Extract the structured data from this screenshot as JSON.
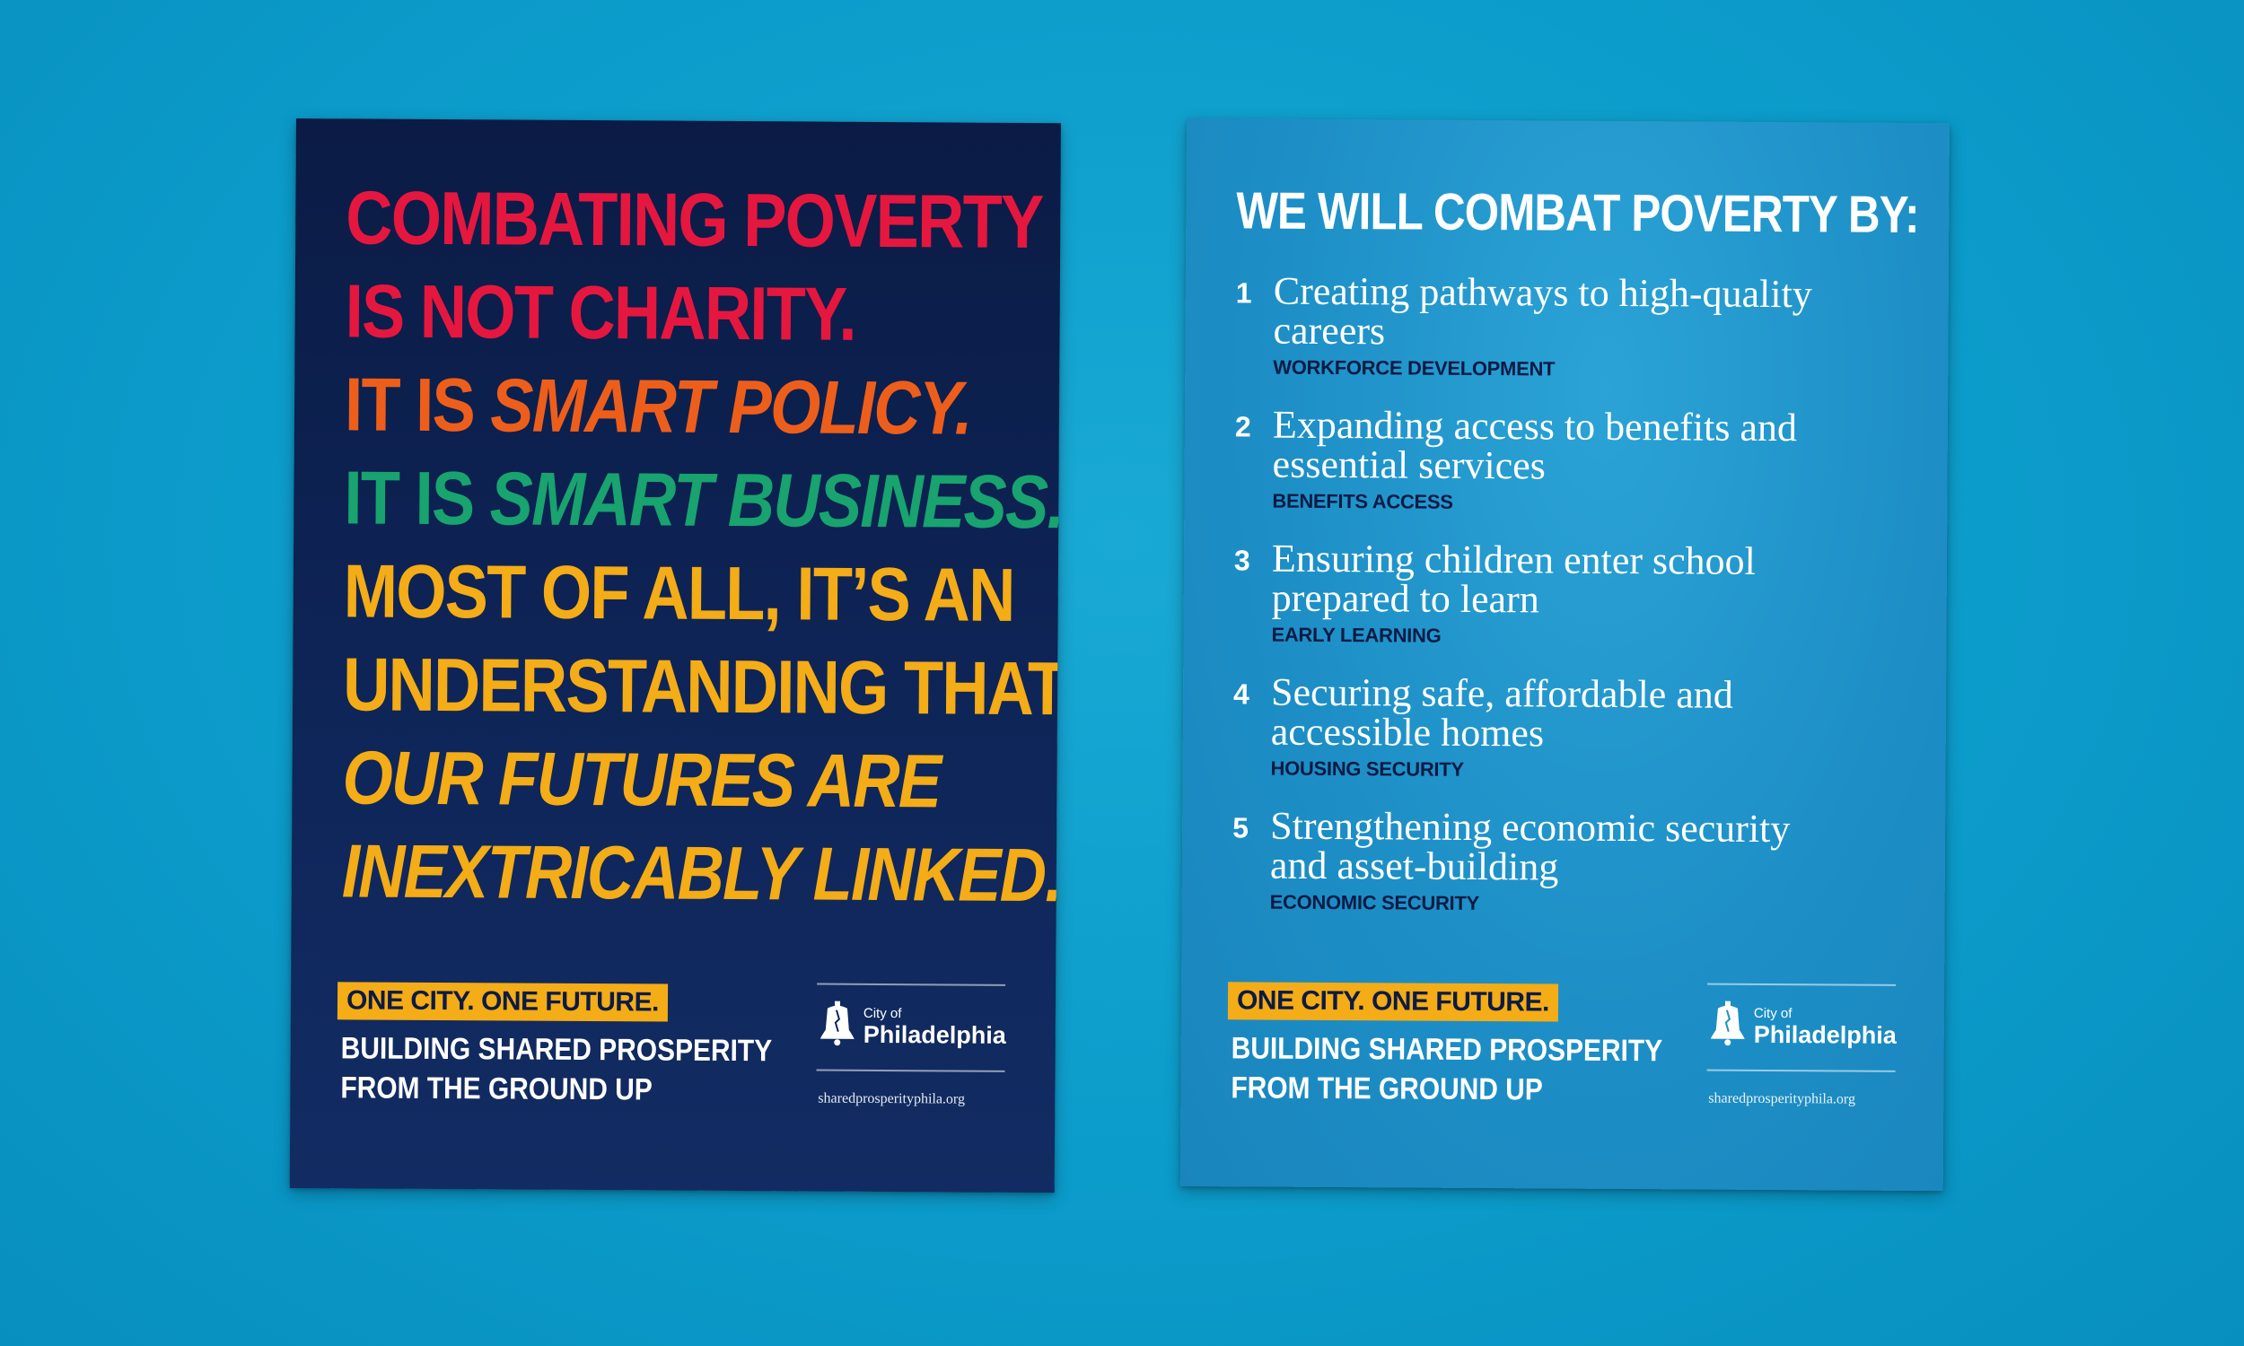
{
  "left_poster": {
    "headline": [
      {
        "text": "COMBATING POVERTY",
        "color": "#e5173f"
      },
      {
        "text": "IS NOT CHARITY.",
        "color": "#e5173f"
      },
      {
        "prefix": "IT IS ",
        "emphasis": "SMART POLICY.",
        "color": "#ee5e1b"
      },
      {
        "prefix": "IT IS ",
        "emphasis": "SMART BUSINESS.",
        "color": "#18a36f"
      },
      {
        "text": "MOST OF ALL, IT’S AN",
        "color": "#f4ac17"
      },
      {
        "text": "UNDERSTANDING THAT",
        "color": "#f4ac17"
      },
      {
        "emphasis": "OUR FUTURES ARE",
        "color": "#f4ac17"
      },
      {
        "emphasis": "INEXTRICABLY LINKED.",
        "color": "#f4ac17"
      }
    ],
    "tagline": "ONE CITY. ONE FUTURE.",
    "subtagline_1": "BUILDING SHARED PROSPERITY",
    "subtagline_2": "FROM THE GROUND UP",
    "logo": {
      "small": "City of",
      "big": "Philadelphia",
      "icon": "liberty-bell-icon"
    },
    "url": "sharedprosperityphila.org"
  },
  "right_poster": {
    "title": "WE WILL COMBAT POVERTY BY:",
    "items": [
      {
        "number": "1",
        "line_1": "Creating pathways to high-quality",
        "line_2": "careers",
        "category": "WORKFORCE DEVELOPMENT"
      },
      {
        "number": "2",
        "line_1": "Expanding access to benefits and",
        "line_2": "essential services",
        "category": "BENEFITS ACCESS"
      },
      {
        "number": "3",
        "line_1": "Ensuring children enter school",
        "line_2": "prepared to learn",
        "category": "EARLY LEARNING"
      },
      {
        "number": "4",
        "line_1": "Securing safe, affordable and",
        "line_2": "accessible homes",
        "category": "HOUSING SECURITY"
      },
      {
        "number": "5",
        "line_1": "Strengthening economic security",
        "line_2": "and asset-building",
        "category": "ECONOMIC SECURITY"
      }
    ],
    "tagline": "ONE CITY. ONE FUTURE.",
    "subtagline_1": "BUILDING SHARED PROSPERITY",
    "subtagline_2": "FROM THE GROUND UP",
    "logo": {
      "small": "City of",
      "big": "Philadelphia",
      "icon": "liberty-bell-icon"
    },
    "url": "sharedprosperityphila.org"
  },
  "colors": {
    "background": "#0c9ccb",
    "navy": "#0b1b45",
    "red": "#e5173f",
    "orange": "#ee5e1b",
    "green": "#18a36f",
    "yellow": "#f4ac17"
  }
}
